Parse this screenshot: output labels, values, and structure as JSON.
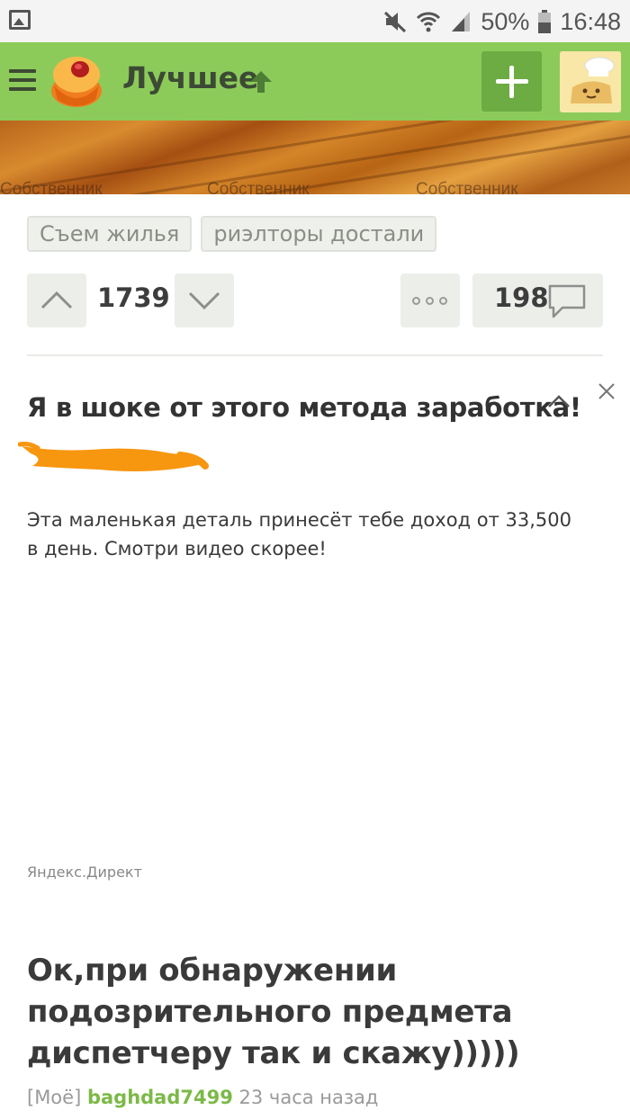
{
  "status_bar": {
    "battery": "50%",
    "time": "16:48"
  },
  "app_bar": {
    "title": "Лучшее"
  },
  "photo": {
    "watermark": "Собственник"
  },
  "post_top": {
    "tags": [
      "Съем жилья",
      "риэлторы достали"
    ],
    "rating": "1739",
    "comments": "198"
  },
  "ad": {
    "title": "Я в шоке от этого метода заработка!",
    "text": "Эта маленькая деталь принесёт тебе доход от 33,500 в день. Смотри видео скорее!",
    "source": "Яндекс.Директ"
  },
  "next_post": {
    "title": "Ок,при обнаружении подозрительного предмета диспетчеру так и скажу)))))",
    "mine_label": "[Моё]",
    "author": "baghdad7499",
    "time": "23 часа назад"
  },
  "colors": {
    "accent_green": "#8ccb5a",
    "author_green": "#7cb948"
  },
  "icons": [
    "gallery-icon",
    "mute-icon",
    "wifi-icon",
    "signal-icon",
    "battery-icon",
    "menu-icon",
    "logo-icon",
    "arrow-up-icon",
    "plus-icon",
    "avatar-icon",
    "chevron-up-icon",
    "chevron-down-icon",
    "more-dots-icon",
    "comment-bubble-icon",
    "collapse-icon",
    "close-icon"
  ]
}
